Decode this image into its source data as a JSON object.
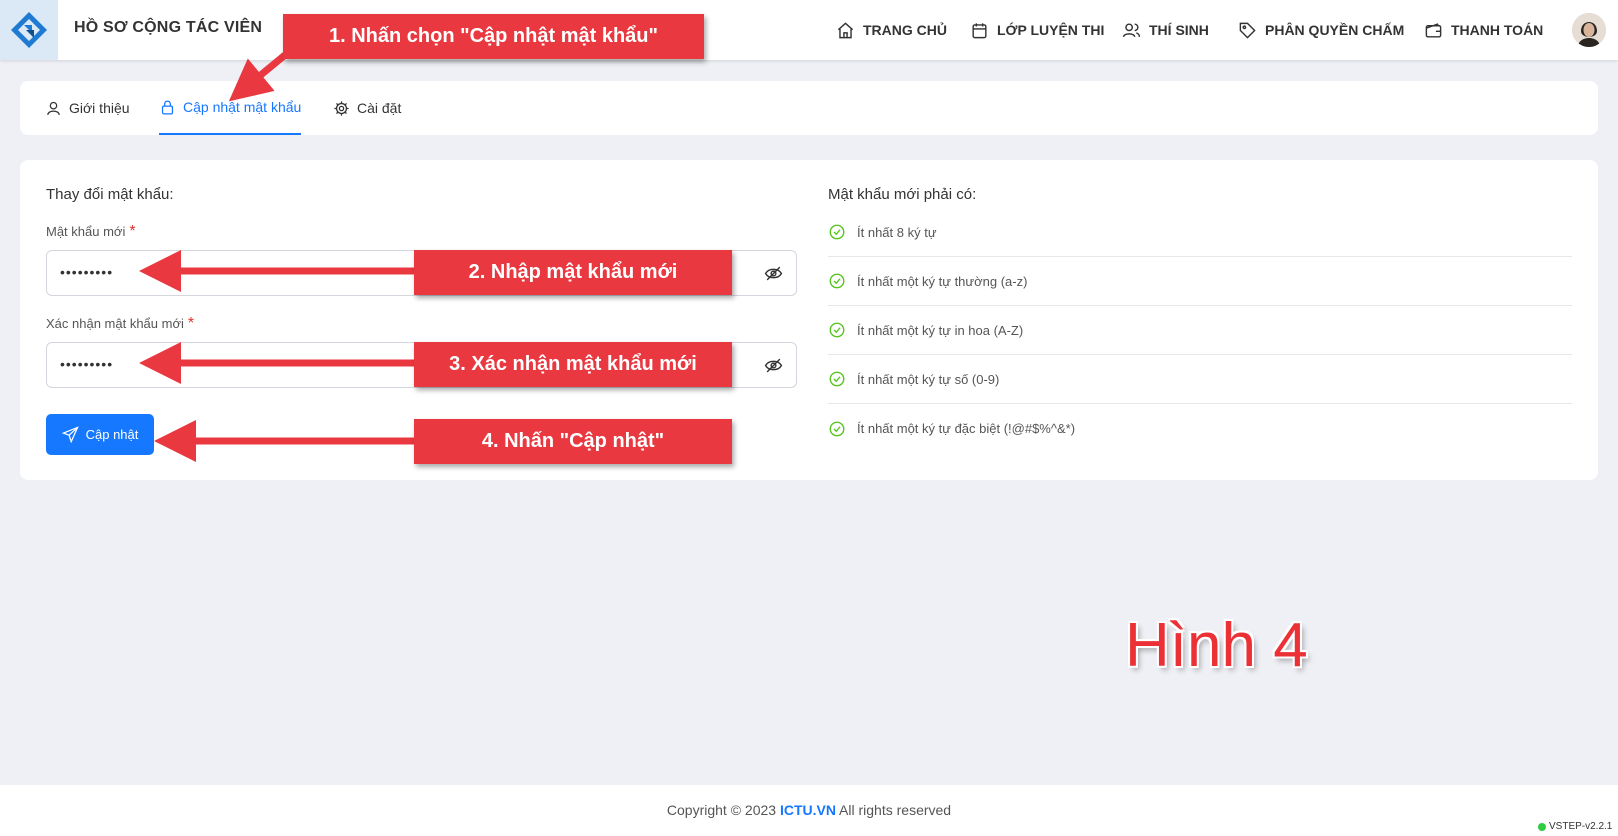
{
  "header": {
    "title": "HỒ SƠ CỘNG TÁC VIÊN",
    "logo_icon": "diamond-logo-icon",
    "nav": [
      {
        "label": "TRANG CHỦ",
        "icon": "home-icon"
      },
      {
        "label": "LỚP LUYỆN THI",
        "icon": "calendar-icon"
      },
      {
        "label": "THÍ SINH",
        "icon": "users-icon"
      },
      {
        "label": "PHÂN QUYỀN CHẤM",
        "icon": "tag-icon"
      },
      {
        "label": "THANH TOÁN",
        "icon": "wallet-icon"
      }
    ],
    "avatar": "user-avatar"
  },
  "tabs": [
    {
      "label": "Giới thiệu",
      "icon": "user-icon",
      "active": false
    },
    {
      "label": "Cập nhật mật khẩu",
      "icon": "lock-icon",
      "active": true
    },
    {
      "label": "Cài đặt",
      "icon": "gear-icon",
      "active": false
    }
  ],
  "form": {
    "title": "Thay đổi mật khẩu:",
    "new_password_label": "Mật khẩu mới",
    "new_password_value": "•••••••••",
    "confirm_label": "Xác nhận mật khẩu mới",
    "confirm_value": "•••••••••",
    "required_mark": "*",
    "submit_label": "Cập nhật"
  },
  "requirements": {
    "title": "Mật khẩu mới phải có:",
    "items": [
      "Ít nhất 8 ký tự",
      "Ít nhất một ký tự thường (a-z)",
      "Ít nhất một ký tự in hoa (A-Z)",
      "Ít nhất một ký tự số (0-9)",
      "Ít nhất một ký tự đặc biệt (!@#$%^&*)"
    ]
  },
  "annotations": {
    "step1": "1. Nhấn chọn \"Cập nhật mật khẩu\"",
    "step2": "2. Nhập mật khẩu mới",
    "step3": "3. Xác nhận mật khẩu mới",
    "step4": "4. Nhấn \"Cập nhật\"",
    "figure": "Hình 4"
  },
  "footer": {
    "copyright_prefix": "Copyright © 2023 ",
    "brand": "ICTU.VN",
    "copyright_suffix": " All rights reserved",
    "version": "VSTEP-v2.2.1"
  },
  "colors": {
    "primary": "#1677ff",
    "annotation": "#e9383f",
    "success": "#52c41a",
    "required": "#e0332b"
  }
}
